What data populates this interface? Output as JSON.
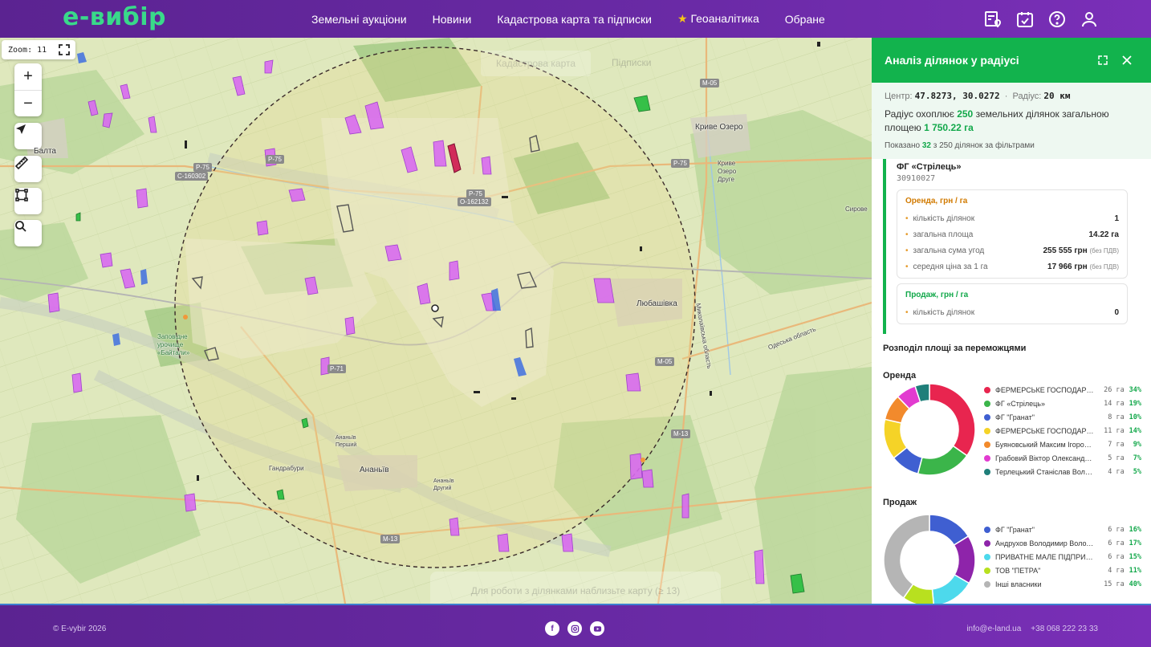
{
  "header": {
    "logo": "e-вибір",
    "nav": [
      {
        "label": "Земельні аукціони"
      },
      {
        "label": "Новини"
      },
      {
        "label": "Кадастрова карта та підписки"
      },
      {
        "label": "Геоаналітика"
      },
      {
        "label": "Обране"
      }
    ],
    "icons": [
      "map-pin-icon",
      "calendar-check-icon",
      "help-icon",
      "user-icon"
    ]
  },
  "map": {
    "zoom_label": "Zoom:",
    "zoom_value": "11",
    "controls": [
      "zoom-in",
      "zoom-out",
      "locate",
      "ruler",
      "polygon",
      "search"
    ],
    "ghost_button": "Кадастрова карта",
    "ghost_tab": "Підписки",
    "hint": "Для роботи з ділянками наблизьте карту (≥ 13)",
    "labels": {
      "balta": "Балта",
      "kryve_ozero": "Криве Озеро",
      "kryve_ozero_druhe": "Криве Озеро Друге",
      "syrove": "Сирове",
      "liubashivka": "Любашівка",
      "ananiv": "Ананьїв",
      "ananiv_pershyi": "Ананьїв Перший",
      "ananiv_druhyi": "Ананьїв Другий",
      "handrabury": "Гандрабури",
      "reserve": "Заповідне урочище «Байтали»",
      "mykolaiv_obl": "Миколаївська область",
      "odesa_obl": "Одеська область"
    },
    "roads": [
      "Р-75",
      "С-160302",
      "Р-75",
      "Р-75",
      "О-162132",
      "Р-75",
      "М-05",
      "М-05",
      "Р-71",
      "М-13",
      "М-13"
    ]
  },
  "panel": {
    "title": "Аналіз ділянок у радіусі",
    "center_label": "Центр:",
    "center_value": "47.8273, 30.0272",
    "radius_label": "Радіус:",
    "radius_value": "20 км",
    "covers_prefix": "Радіус охоплює",
    "covers_count": "250",
    "covers_mid": "земельних ділянок загальною площею",
    "covers_area": "1 750.22 га",
    "shown_prefix": "Показано",
    "shown_count": "32",
    "shown_suffix": "з 250 ділянок за фільтрами",
    "winner": {
      "name": "ФГ «Стрілець»",
      "code": "30910027",
      "rent": {
        "title": "Оренда, грн / га",
        "rows": [
          {
            "label": "кількість ділянок",
            "value": "1",
            "note": ""
          },
          {
            "label": "загальна площа",
            "value": "14.22 га",
            "note": ""
          },
          {
            "label": "загальна сума угод",
            "value": "255 555 грн",
            "note": "(без ПДВ)"
          },
          {
            "label": "середня ціна за 1 га",
            "value": "17 966 грн",
            "note": "(без ПДВ)"
          }
        ]
      },
      "sale": {
        "title": "Продаж, грн / га",
        "rows": [
          {
            "label": "кількість ділянок",
            "value": "0",
            "note": ""
          }
        ]
      }
    },
    "distribution_title": "Розподіл площі за переможцями",
    "rent_label": "Оренда",
    "sale_label": "Продаж"
  },
  "chart_data": [
    {
      "type": "pie",
      "title": "Оренда",
      "categories": [
        "ФЕРМЕРСЬКЕ ГОСПОДАРСТВО",
        "ФГ «Стрілець»",
        "ФГ \"Гранат\"",
        "ФЕРМЕРСЬКЕ ГОСПОДАРСТВО",
        "Буяновський Максим Ігорович",
        "Грабовий Віктор Олександрович",
        "Терлецький Станіслав Володимирович"
      ],
      "ha_labels": [
        "26 га",
        "14 га",
        "8 га",
        "11 га",
        "7 га",
        "5 га",
        "4 га"
      ],
      "pct_labels": [
        "34%",
        "19%",
        "10%",
        "14%",
        "9%",
        "7%",
        "5%"
      ],
      "values": [
        34,
        19,
        10,
        14,
        9,
        7,
        5
      ],
      "colors": [
        "#e8254f",
        "#3bb54a",
        "#3f5fd1",
        "#f5d327",
        "#f28a2c",
        "#e23bd0",
        "#1f7f7a"
      ]
    },
    {
      "type": "pie",
      "title": "Продаж",
      "categories": [
        "ФГ \"Гранат\"",
        "Андрухов Володимир Володимирович",
        "ПРИВАТНЕ МАЛЕ ПІДПРИЄМСТВО",
        "ТОВ \"ПЕТРА\"",
        "Інші власники"
      ],
      "ha_labels": [
        "6 га",
        "6 га",
        "6 га",
        "4 га",
        "15 га"
      ],
      "pct_labels": [
        "16%",
        "17%",
        "15%",
        "11%",
        "40%"
      ],
      "values": [
        16,
        17,
        15,
        11,
        40
      ],
      "colors": [
        "#3f5fd1",
        "#8e24aa",
        "#4dd9ec",
        "#b8e01f",
        "#b5b5b5"
      ]
    }
  ],
  "footer": {
    "copyright": "© E-vybir 2026",
    "socials": [
      "facebook-icon",
      "instagram-icon",
      "youtube-icon"
    ],
    "email": "info@e-land.ua",
    "phone": "+38 068 222 23 33"
  }
}
